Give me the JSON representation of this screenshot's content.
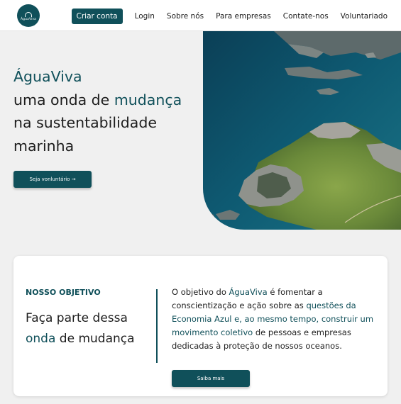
{
  "header": {
    "logo_text": "ÁguaViva",
    "nav": {
      "create_account": "Criar conta",
      "login": "Login",
      "about": "Sobre nós",
      "business": "Para empresas",
      "contact": "Contate-nos",
      "volunteer": "Voluntariado"
    }
  },
  "hero": {
    "brand": "ÁguaViva",
    "line2_a": "uma onda de ",
    "line2_accent": "mudança",
    "line3": "na sustentabilidade",
    "line4": "marinha",
    "button_label": "Seja vonluntário →"
  },
  "objective": {
    "label": "NOSSO OBJETIVO",
    "title_1": "Faça parte dessa",
    "title_accent": "onda",
    "title_2": " de mudança",
    "text_1": "O objetivo do ",
    "text_brand": "ÁguaViva",
    "text_2": " é fomentar a conscientização e ação sobre as ",
    "text_accent": "questões da Economia Azul e, ao mesmo tempo, construir um movimento coletivo",
    "text_3": " de pessoas e empresas dedicadas à proteção de nossos oceanos.",
    "button_label": "Saiba mais"
  },
  "colors": {
    "accent": "#10505a",
    "background": "#f0f0f0"
  }
}
